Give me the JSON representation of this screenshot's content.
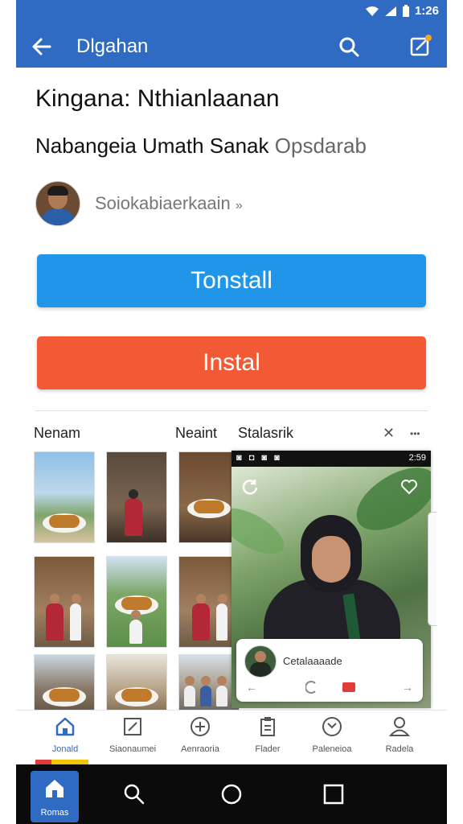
{
  "status_bar": {
    "time": "1:26"
  },
  "app_bar": {
    "title": "Dlgahan"
  },
  "content": {
    "title": "Kingana: Nthianlaanan",
    "subtitle_main": "Nabangeia Umath Sanak",
    "subtitle_muted": "Opsdarab",
    "author": {
      "name": "Soiokabiaerkaain",
      "chevron": "»"
    }
  },
  "buttons": {
    "primary_label": "Tonstall",
    "secondary_label": "Instal"
  },
  "colors": {
    "accent": "#2f6bc2",
    "primary_button": "#2196e9",
    "secondary_button": "#f15a35"
  },
  "tabs": {
    "first": "Nenam",
    "second": "Neaint",
    "third": "Stalasrik",
    "close": "✕",
    "more": "•••"
  },
  "preview": {
    "status_left": "◙ ◘ ◙ ◙",
    "status_time": "2:59",
    "card_name": "Cetalaaaade",
    "card_back": "←",
    "card_forward": "→"
  },
  "bottom_nav": [
    {
      "label": "Jonald",
      "icon": "home-icon"
    },
    {
      "label": "Siaonaumei",
      "icon": "edit-icon"
    },
    {
      "label": "Aenraoria",
      "icon": "plus-circle-icon"
    },
    {
      "label": "Flader",
      "icon": "clipboard-icon"
    },
    {
      "label": "Paleneioa",
      "icon": "clock-icon"
    },
    {
      "label": "Radela",
      "icon": "person-icon"
    }
  ],
  "system_bar": {
    "home_label": "Romas"
  }
}
